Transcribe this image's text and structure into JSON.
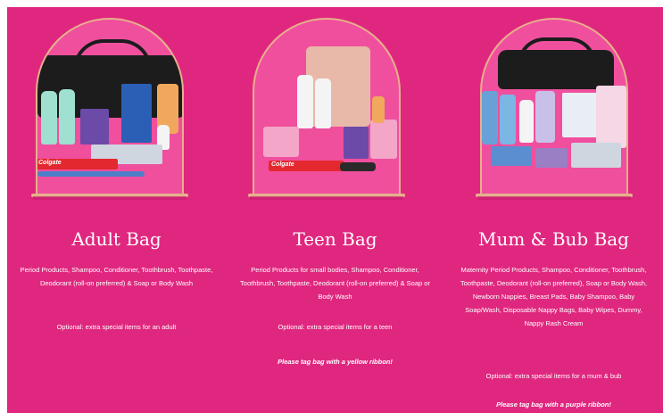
{
  "bags": [
    {
      "title": "Adult Bag",
      "description": "Period Products, Shampoo, Conditioner, Toothbrush, Toothpaste, Deodorant (roll-on preferred) & Soap or Body Wash",
      "optional": "Optional: extra special items for an adult",
      "note": "",
      "image_alt": "adult-bag-products",
      "toothpaste_brand": "Colgate"
    },
    {
      "title": "Teen Bag",
      "description": "Period Products for small bodies, Shampoo, Conditioner, Toothbrush, Toothpaste, Deodorant (roll-on preferred) & Soap or Body Wash",
      "optional": "Optional: extra special items for a teen",
      "note": "Please tag bag with a yellow ribbon!",
      "image_alt": "teen-bag-products",
      "toothpaste_brand": "Colgate"
    },
    {
      "title": "Mum & Bub Bag",
      "description": "Maternity Period Products, Shampoo, Conditioner, Toothbrush, Toothpaste, Deodorant (roll-on preferred), Soap or Body Wash, Newborn Nappies, Breast Pads, Baby Shampoo, Baby Soap/Wash, Disposable Nappy Bags, Baby Wipes, Dummy, Nappy Rash Cream",
      "optional": "Optional: extra special items for a mum & bub",
      "note": "Please tag bag with a purple ribbon!",
      "image_alt": "mum-bub-bag-products",
      "toothpaste_brand": ""
    }
  ],
  "colors": {
    "background": "#e0277f",
    "arch": "#f04f9e",
    "arch_border": "#e7b08c",
    "text": "#ffffff"
  }
}
